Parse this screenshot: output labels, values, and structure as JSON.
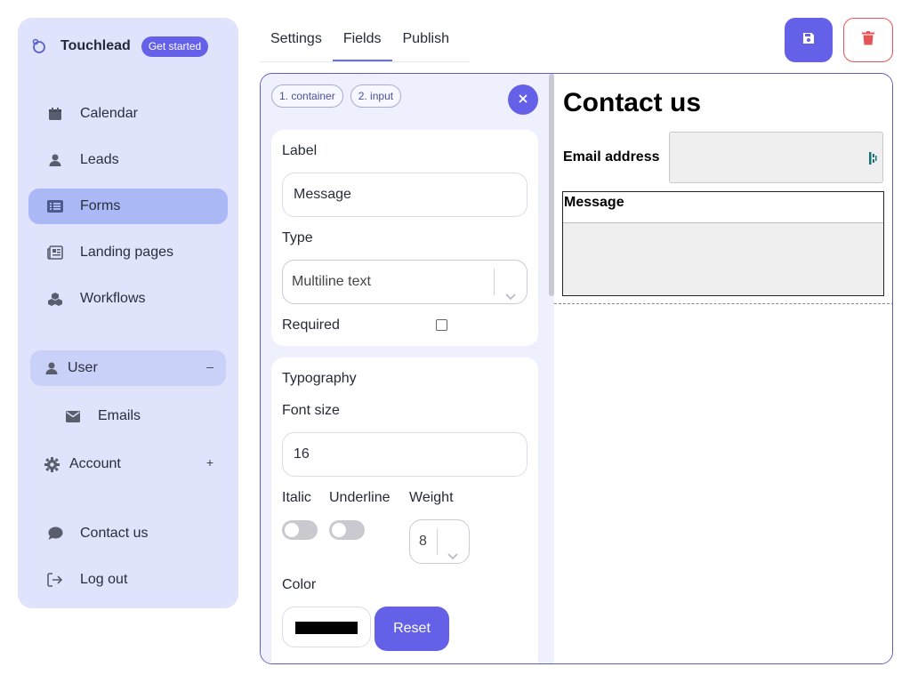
{
  "brand": {
    "name": "Touchlead",
    "cta": "Get started"
  },
  "nav": {
    "calendar": "Calendar",
    "leads": "Leads",
    "forms": "Forms",
    "landing_pages": "Landing pages",
    "workflows": "Workflows",
    "user": {
      "label": "User",
      "toggle": "–"
    },
    "emails": "Emails",
    "account": {
      "label": "Account",
      "toggle": "+"
    },
    "contact": "Contact us",
    "logout": "Log out"
  },
  "tabs": [
    {
      "label": "Settings",
      "active": false
    },
    {
      "label": "Fields",
      "active": true
    },
    {
      "label": "Publish",
      "active": false
    }
  ],
  "panel": {
    "breadcrumbs": [
      "1. container",
      "2. input"
    ],
    "label_heading": "Label",
    "label_value": "Message",
    "type_heading": "Type",
    "type_value": "Multiline text",
    "required_label": "Required",
    "required_checked": false,
    "typography_heading": "Typography",
    "font_size_heading": "Font size",
    "font_size_value": "16",
    "italic_label": "Italic",
    "underline_label": "Underline",
    "weight_label": "Weight",
    "weight_value": "8",
    "color_label": "Color",
    "color_value": "#000000",
    "reset_label": "Reset"
  },
  "preview": {
    "title": "Contact us",
    "email_label": "Email address",
    "message_label": "Message"
  },
  "colors": {
    "accent": "#6461e8",
    "sidebar_bg": "#dfe3fb",
    "active_nav": "#aab8f6",
    "danger": "#e45555"
  },
  "icons": [
    "logo-icon",
    "calendar-icon",
    "user-icon",
    "list-icon",
    "newspaper-icon",
    "cubes-icon",
    "envelope-icon",
    "gear-icon",
    "comment-icon",
    "logout-icon",
    "save-icon",
    "trash-icon",
    "close-icon",
    "chevron-down-icon"
  ]
}
